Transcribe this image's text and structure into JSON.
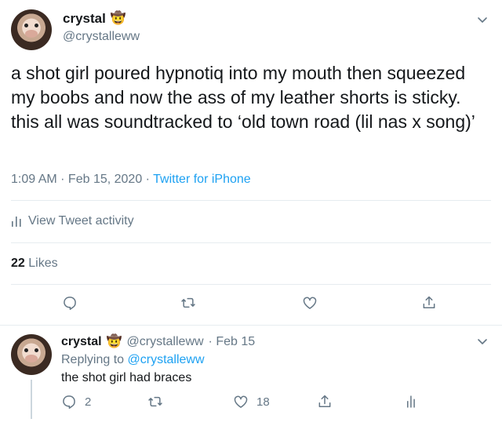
{
  "tweet": {
    "display_name": "crystal",
    "name_emoji": "🤠",
    "handle": "@crystalleww",
    "text": "a shot girl poured hypnotiq into my mouth then squeezed my boobs and now the ass of my leather shorts is sticky. this all was soundtracked to ‘old town road (lil nas x song)’",
    "timestamp": "1:09 AM · Feb 15, 2020",
    "meta_separator": " · ",
    "source": "Twitter for iPhone",
    "activity_label": "View Tweet activity",
    "likes_count": "22",
    "likes_label": "Likes"
  },
  "reply": {
    "display_name": "crystal",
    "name_emoji": "🤠",
    "handle": "@crystalleww",
    "date": "· Feb 15",
    "replying_prefix": "Replying to",
    "replying_to": "@crystalleww",
    "text": "the shot girl had braces",
    "reply_count": "2",
    "like_count": "18"
  },
  "icons": {
    "more": "chevron-down-icon",
    "reply": "reply-icon",
    "retweet": "retweet-icon",
    "like": "heart-icon",
    "share": "share-icon",
    "activity": "analytics-icon"
  },
  "colors": {
    "text": "#14171a",
    "muted": "#657786",
    "link": "#1da1f2",
    "divider": "#e6ecf0"
  }
}
